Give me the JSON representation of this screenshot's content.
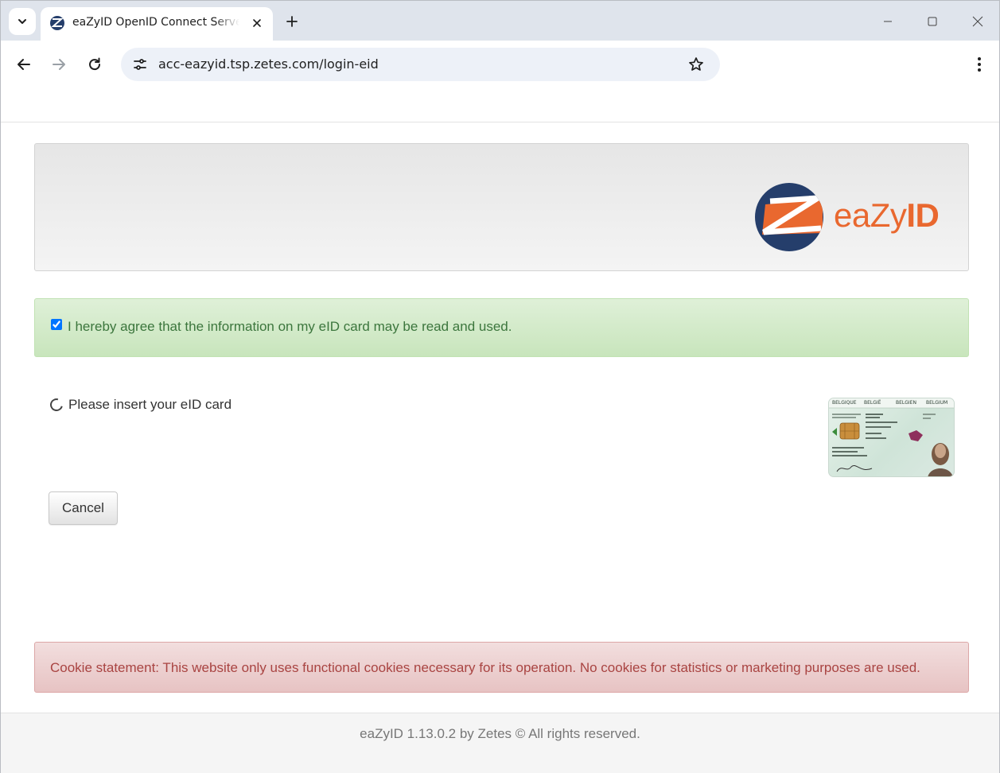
{
  "browser": {
    "tab_title": "eaZyID OpenID Connect Server - Login",
    "url": "acc-eazyid.tsp.zetes.com/login-eid"
  },
  "header": {
    "logo_text_light": "eaZy",
    "logo_text_bold": "ID",
    "logo_color": "#e9682f",
    "logo_mark_color": "#253e6b"
  },
  "consent": {
    "checked": true,
    "label": "I hereby agree that the information on my eID card may be read and used."
  },
  "status": {
    "text": "Please insert your eID card",
    "icon": "loading-spinner-icon"
  },
  "card": {
    "headers": [
      "BELGIQUE",
      "BELGIË",
      "BELGIEN",
      "BELGIUM"
    ]
  },
  "actions": {
    "cancel_label": "Cancel"
  },
  "cookie": {
    "text": "Cookie statement: This website only uses functional cookies necessary for its operation. No cookies for statistics or marketing purposes are used."
  },
  "footer": {
    "text": "eaZyID 1.13.0.2 by Zetes © All rights reserved."
  }
}
